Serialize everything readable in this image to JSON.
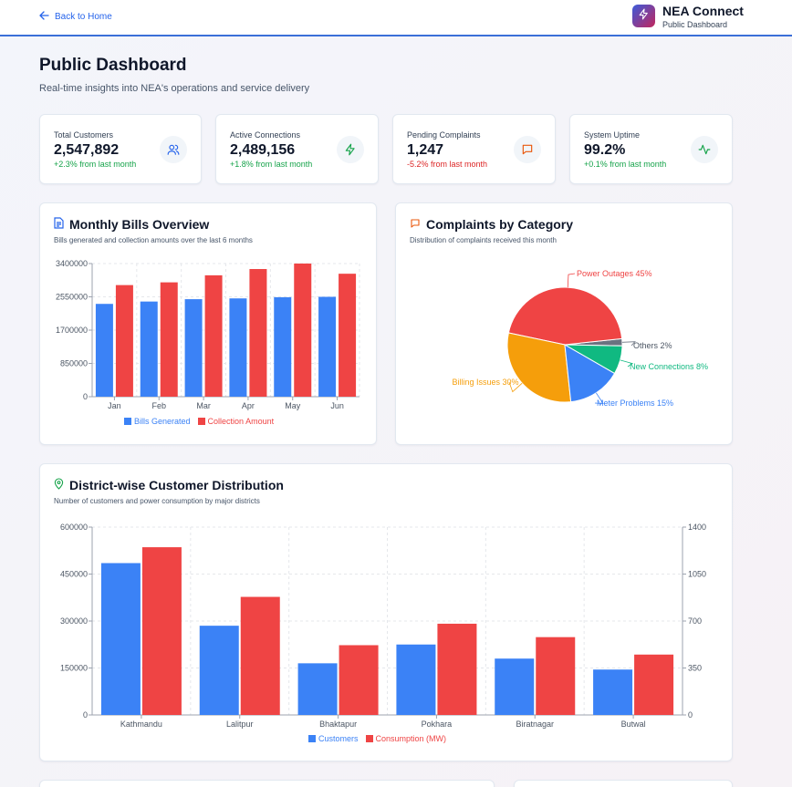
{
  "header": {
    "back_label": "Back to Home",
    "brand_name": "NEA Connect",
    "brand_sub": "Public Dashboard"
  },
  "page": {
    "title": "Public Dashboard",
    "subtitle": "Real-time insights into NEA's operations and service delivery"
  },
  "stats": [
    {
      "label": "Total Customers",
      "value": "2,547,892",
      "delta": "+2.3% from last month",
      "trend": "up",
      "icon": "users-icon",
      "icon_color": "#2563eb"
    },
    {
      "label": "Active Connections",
      "value": "2,489,156",
      "delta": "+1.8% from last month",
      "trend": "up",
      "icon": "zap-icon",
      "icon_color": "#16a34a"
    },
    {
      "label": "Pending Complaints",
      "value": "1,247",
      "delta": "-5.2% from last month",
      "trend": "down",
      "icon": "message-icon",
      "icon_color": "#ea580c"
    },
    {
      "label": "System Uptime",
      "value": "99.2%",
      "delta": "+0.1% from last month",
      "trend": "up",
      "icon": "activity-icon",
      "icon_color": "#16a34a"
    }
  ],
  "bills_panel": {
    "title": "Monthly Bills Overview",
    "subtitle": "Bills generated and collection amounts over the last 6 months"
  },
  "complaints_panel": {
    "title": "Complaints by Category",
    "subtitle": "Distribution of complaints received this month"
  },
  "district_panel": {
    "title": "District-wise Customer Distribution",
    "subtitle": "Number of customers and power consumption by major districts"
  },
  "colors": {
    "blue": "#3b82f6",
    "red": "#ef4444",
    "orange": "#f59e0b",
    "green": "#10b981",
    "gray": "#6b7280",
    "accent": "#3b6fd8"
  },
  "chart_data": [
    {
      "type": "bar",
      "categories": [
        "Jan",
        "Feb",
        "Mar",
        "Apr",
        "May",
        "Jun"
      ],
      "series": [
        {
          "name": "Bills Generated",
          "values": [
            2370000,
            2430000,
            2490000,
            2510000,
            2540000,
            2550000
          ]
        },
        {
          "name": "Collection Amount",
          "values": [
            2850000,
            2920000,
            3100000,
            3260000,
            3400000,
            3140000
          ]
        }
      ],
      "yticks": [
        "0",
        "850000",
        "1700000",
        "2550000",
        "3400000"
      ],
      "ylim": [
        0,
        3400000
      ],
      "grid": true,
      "legend": "bottom"
    },
    {
      "type": "pie",
      "slices": [
        {
          "label": "Power Outages 45%",
          "value": 45
        },
        {
          "label": "Billing Issues 30%",
          "value": 30
        },
        {
          "label": "Meter Problems 15%",
          "value": 15
        },
        {
          "label": "New Connections 8%",
          "value": 8
        },
        {
          "label": "Others 2%",
          "value": 2
        }
      ]
    },
    {
      "type": "bar",
      "categories": [
        "Kathmandu",
        "Lalitpur",
        "Bhaktapur",
        "Pokhara",
        "Biratnagar",
        "Butwal"
      ],
      "series": [
        {
          "name": "Customers",
          "values": [
            485000,
            285000,
            165000,
            225000,
            180000,
            145000
          ],
          "axis": "left"
        },
        {
          "name": "Consumption (MW)",
          "values": [
            1250,
            880,
            520,
            680,
            580,
            450
          ],
          "axis": "right"
        }
      ],
      "yticks_left": [
        "0",
        "150000",
        "300000",
        "450000",
        "600000"
      ],
      "yticks_right": [
        "0",
        "350",
        "700",
        "1050",
        "1400"
      ],
      "ylim_left": [
        0,
        600000
      ],
      "ylim_right": [
        0,
        1400
      ],
      "grid": true,
      "legend": "bottom"
    }
  ]
}
